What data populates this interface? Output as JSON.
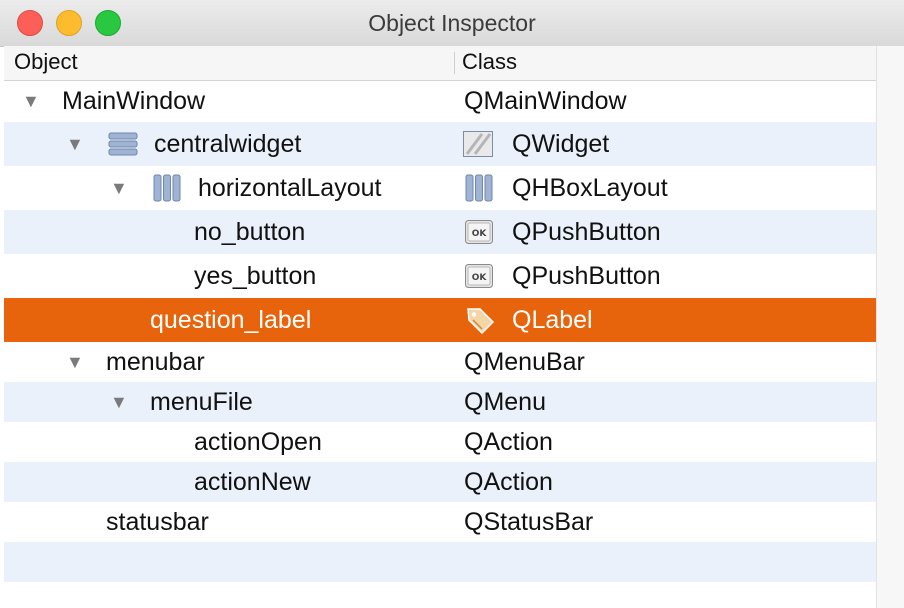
{
  "window": {
    "title": "Object Inspector"
  },
  "header": {
    "object_label": "Object",
    "class_label": "Class"
  },
  "rows": [
    {
      "name": "MainWindow",
      "class": "QMainWindow",
      "expanded": true
    },
    {
      "name": "centralwidget",
      "class": "QWidget",
      "expanded": true,
      "icon": "layout-vertical-icon",
      "class_icon": "widget-icon"
    },
    {
      "name": "horizontalLayout",
      "class": "QHBoxLayout",
      "expanded": true,
      "icon": "layout-horizontal-icon",
      "class_icon": "hbox-layout-icon"
    },
    {
      "name": "no_button",
      "class": "QPushButton",
      "class_icon": "push-button-icon"
    },
    {
      "name": "yes_button",
      "class": "QPushButton",
      "class_icon": "push-button-icon"
    },
    {
      "name": "question_label",
      "class": "QLabel",
      "selected": true,
      "class_icon": "label-tag-icon"
    },
    {
      "name": "menubar",
      "class": "QMenuBar",
      "expanded": true
    },
    {
      "name": "menuFile",
      "class": "QMenu",
      "expanded": true
    },
    {
      "name": "actionOpen",
      "class": "QAction"
    },
    {
      "name": "actionNew",
      "class": "QAction"
    },
    {
      "name": "statusbar",
      "class": "QStatusBar"
    }
  ],
  "colors": {
    "selection": "#e8640c",
    "alternate_row": "#eaf1fb"
  }
}
